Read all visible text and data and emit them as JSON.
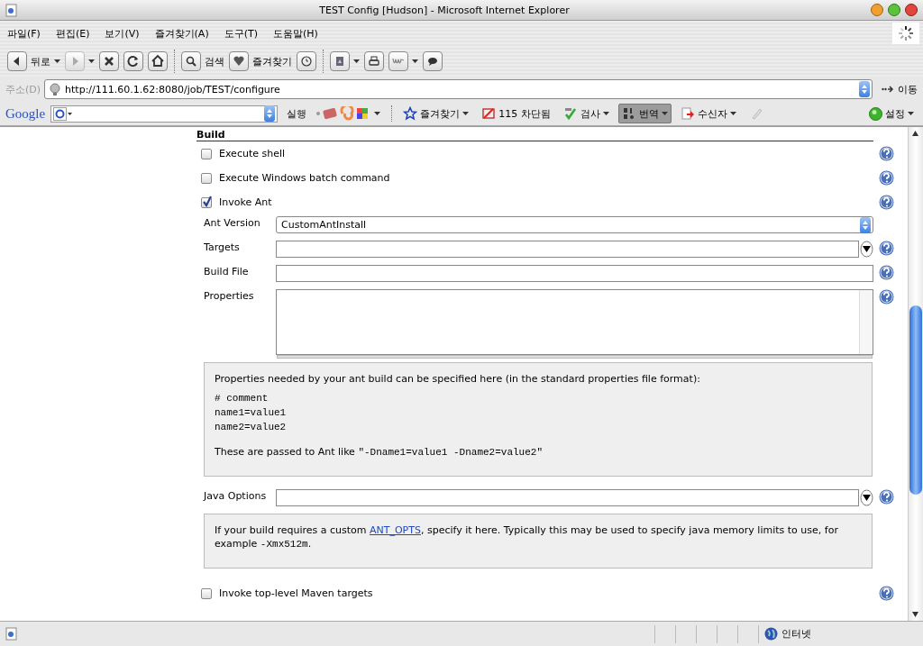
{
  "window": {
    "title": "TEST Config [Hudson] - Microsoft Internet Explorer"
  },
  "menu": [
    "파일(F)",
    "편집(E)",
    "보기(V)",
    "즐겨찾기(A)",
    "도구(T)",
    "도움말(H)"
  ],
  "toolbar": [
    {
      "kind": "back",
      "label": "뒤로",
      "dropdown": true,
      "disabled": false
    },
    {
      "kind": "forward",
      "dropdown": true,
      "disabled": true
    },
    {
      "kind": "stop",
      "dropdown": false,
      "disabled": false
    },
    {
      "kind": "refresh",
      "dropdown": false,
      "disabled": false
    },
    {
      "kind": "home",
      "dropdown": false,
      "disabled": false
    },
    {
      "kind": "separator"
    },
    {
      "kind": "search",
      "label": "검색",
      "dropdown": false,
      "disabled": false
    },
    {
      "kind": "favorites",
      "label": "즐겨찾기",
      "dropdown": false,
      "disabled": false
    },
    {
      "kind": "history",
      "dropdown": false,
      "disabled": false
    },
    {
      "kind": "separator"
    },
    {
      "kind": "mail",
      "dropdown": true,
      "disabled": false
    },
    {
      "kind": "print",
      "dropdown": false,
      "disabled": false
    },
    {
      "kind": "edit",
      "dropdown": true,
      "disabled": false
    },
    {
      "kind": "messenger",
      "dropdown": false,
      "disabled": false
    }
  ],
  "address": {
    "label": "주소(D)",
    "url": "http://111.60.1.62:8080/job/TEST/configure",
    "go": "이동"
  },
  "google_bar": {
    "logo": "Google",
    "run": "실행",
    "items": [
      {
        "kind": "bookmarks",
        "label": "즐겨찾기",
        "dropdown": true,
        "selected": false
      },
      {
        "kind": "popup",
        "label": "115 차단됨",
        "dropdown": false,
        "selected": false
      },
      {
        "kind": "spell",
        "label": "검사",
        "dropdown": true,
        "selected": false
      },
      {
        "kind": "translate",
        "label": "번역",
        "dropdown": true,
        "selected": true
      },
      {
        "kind": "send",
        "label": "수신자",
        "dropdown": true,
        "selected": false
      },
      {
        "kind": "pencil",
        "dropdown": false,
        "selected": false
      }
    ],
    "settings": "설정"
  },
  "build": {
    "title": "Build",
    "items": [
      {
        "kind": "checkbox",
        "label": "Execute shell",
        "checked": false,
        "help": true
      },
      {
        "kind": "checkbox",
        "label": "Execute Windows batch command",
        "checked": false,
        "help": true
      },
      {
        "kind": "checkbox",
        "label": "Invoke Ant",
        "checked": true,
        "help": true
      },
      {
        "kind": "select",
        "label": "Ant Version",
        "value": "CustomAntInstall",
        "help": false
      },
      {
        "kind": "text",
        "label": "Targets",
        "expandable": true,
        "help": true
      },
      {
        "kind": "text",
        "label": "Build File",
        "expandable": false,
        "help": true
      },
      {
        "kind": "textarea",
        "label": "Properties",
        "help": true
      },
      {
        "kind": "note",
        "paragraphs": [
          [
            {
              "kind": "plain",
              "text": "Properties needed by your ant build can be specified here (in the standard properties file format):"
            }
          ],
          [
            {
              "kind": "code",
              "text": "# comment"
            }
          ],
          [
            {
              "kind": "code",
              "text": "name1=value1"
            }
          ],
          [
            {
              "kind": "code",
              "text": "name2=value2"
            }
          ],
          [
            {
              "kind": "plain",
              "text": "These are passed to Ant like "
            },
            {
              "kind": "code",
              "text": "\"-Dname1=value1 -Dname2=value2\""
            }
          ]
        ]
      },
      {
        "kind": "text",
        "label": "Java Options",
        "expandable": true,
        "help": true
      },
      {
        "kind": "note",
        "paragraphs": [
          [
            {
              "kind": "plain",
              "text": "If your build requires a custom "
            },
            {
              "kind": "link",
              "text": "ANT_OPTS"
            },
            {
              "kind": "plain",
              "text": ", specify it here. Typically this may be used to specify java memory limits to use, for example "
            },
            {
              "kind": "code",
              "text": "-Xmx512m"
            },
            {
              "kind": "plain",
              "text": "."
            }
          ]
        ]
      },
      {
        "kind": "checkbox",
        "label": "Invoke top-level Maven targets",
        "checked": false,
        "help": true
      }
    ]
  },
  "status_bar": {
    "zone": "인터넷"
  }
}
